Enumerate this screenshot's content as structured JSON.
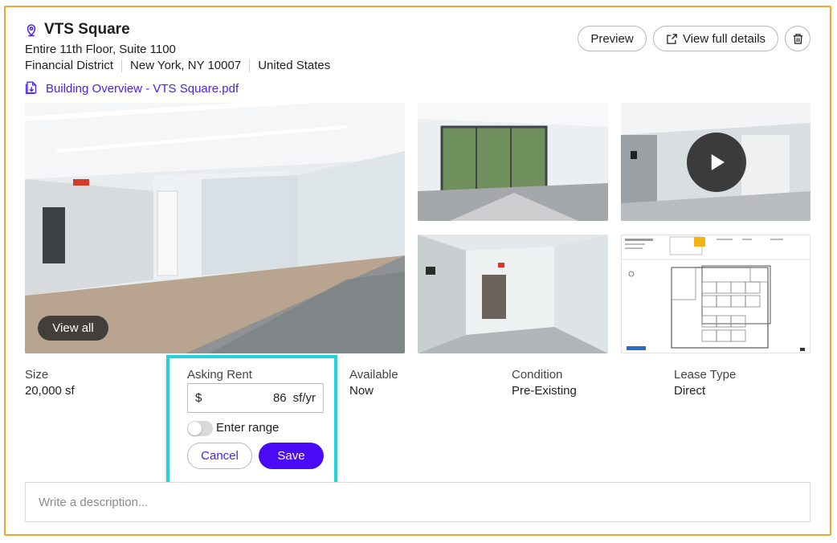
{
  "listing": {
    "title": "VTS Square",
    "subtitle": "Entire 11th Floor, Suite 1100",
    "address": [
      "Financial District",
      "New York, NY 10007",
      "United States"
    ],
    "attachment": "Building Overview - VTS Square.pdf"
  },
  "actions": {
    "preview": "Preview",
    "view_details": "View full details"
  },
  "gallery": {
    "view_all": "View all"
  },
  "fields": {
    "size": {
      "label": "Size",
      "value": "20,000 sf"
    },
    "available": {
      "label": "Available",
      "value": "Now"
    },
    "condition": {
      "label": "Condition",
      "value": "Pre-Existing"
    },
    "lease_type": {
      "label": "Lease Type",
      "value": "Direct"
    }
  },
  "rent_editor": {
    "label": "Asking Rent",
    "currency": "$",
    "amount": "86",
    "unit": "sf/yr",
    "range_toggle_label": "Enter range",
    "range_enabled": false,
    "cancel": "Cancel",
    "save": "Save"
  },
  "description": {
    "placeholder": "Write a description...",
    "value": ""
  },
  "colors": {
    "accent": "#4a0af5",
    "link": "#4a22e8",
    "card_border": "#f3a531",
    "focus_ring": "#22d3d8"
  },
  "icons": [
    "location-pin-icon",
    "pdf-download-icon",
    "external-link-icon",
    "trash-icon",
    "play-icon"
  ]
}
